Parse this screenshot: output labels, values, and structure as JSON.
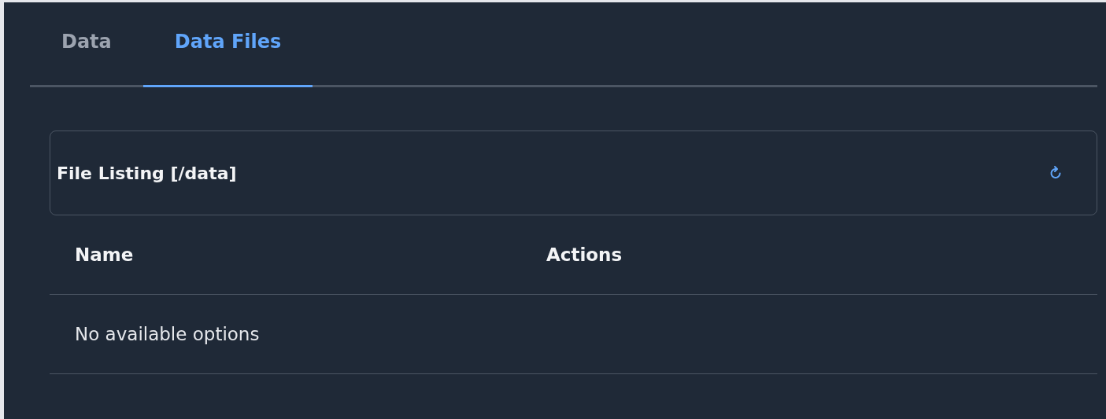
{
  "tabs": [
    {
      "label": "Data",
      "selected": false
    },
    {
      "label": "Data Files",
      "selected": true
    }
  ],
  "file_listing": {
    "title": "File Listing [/data]"
  },
  "table": {
    "columns": [
      "Name",
      "Actions"
    ],
    "empty_message": "No available options"
  }
}
